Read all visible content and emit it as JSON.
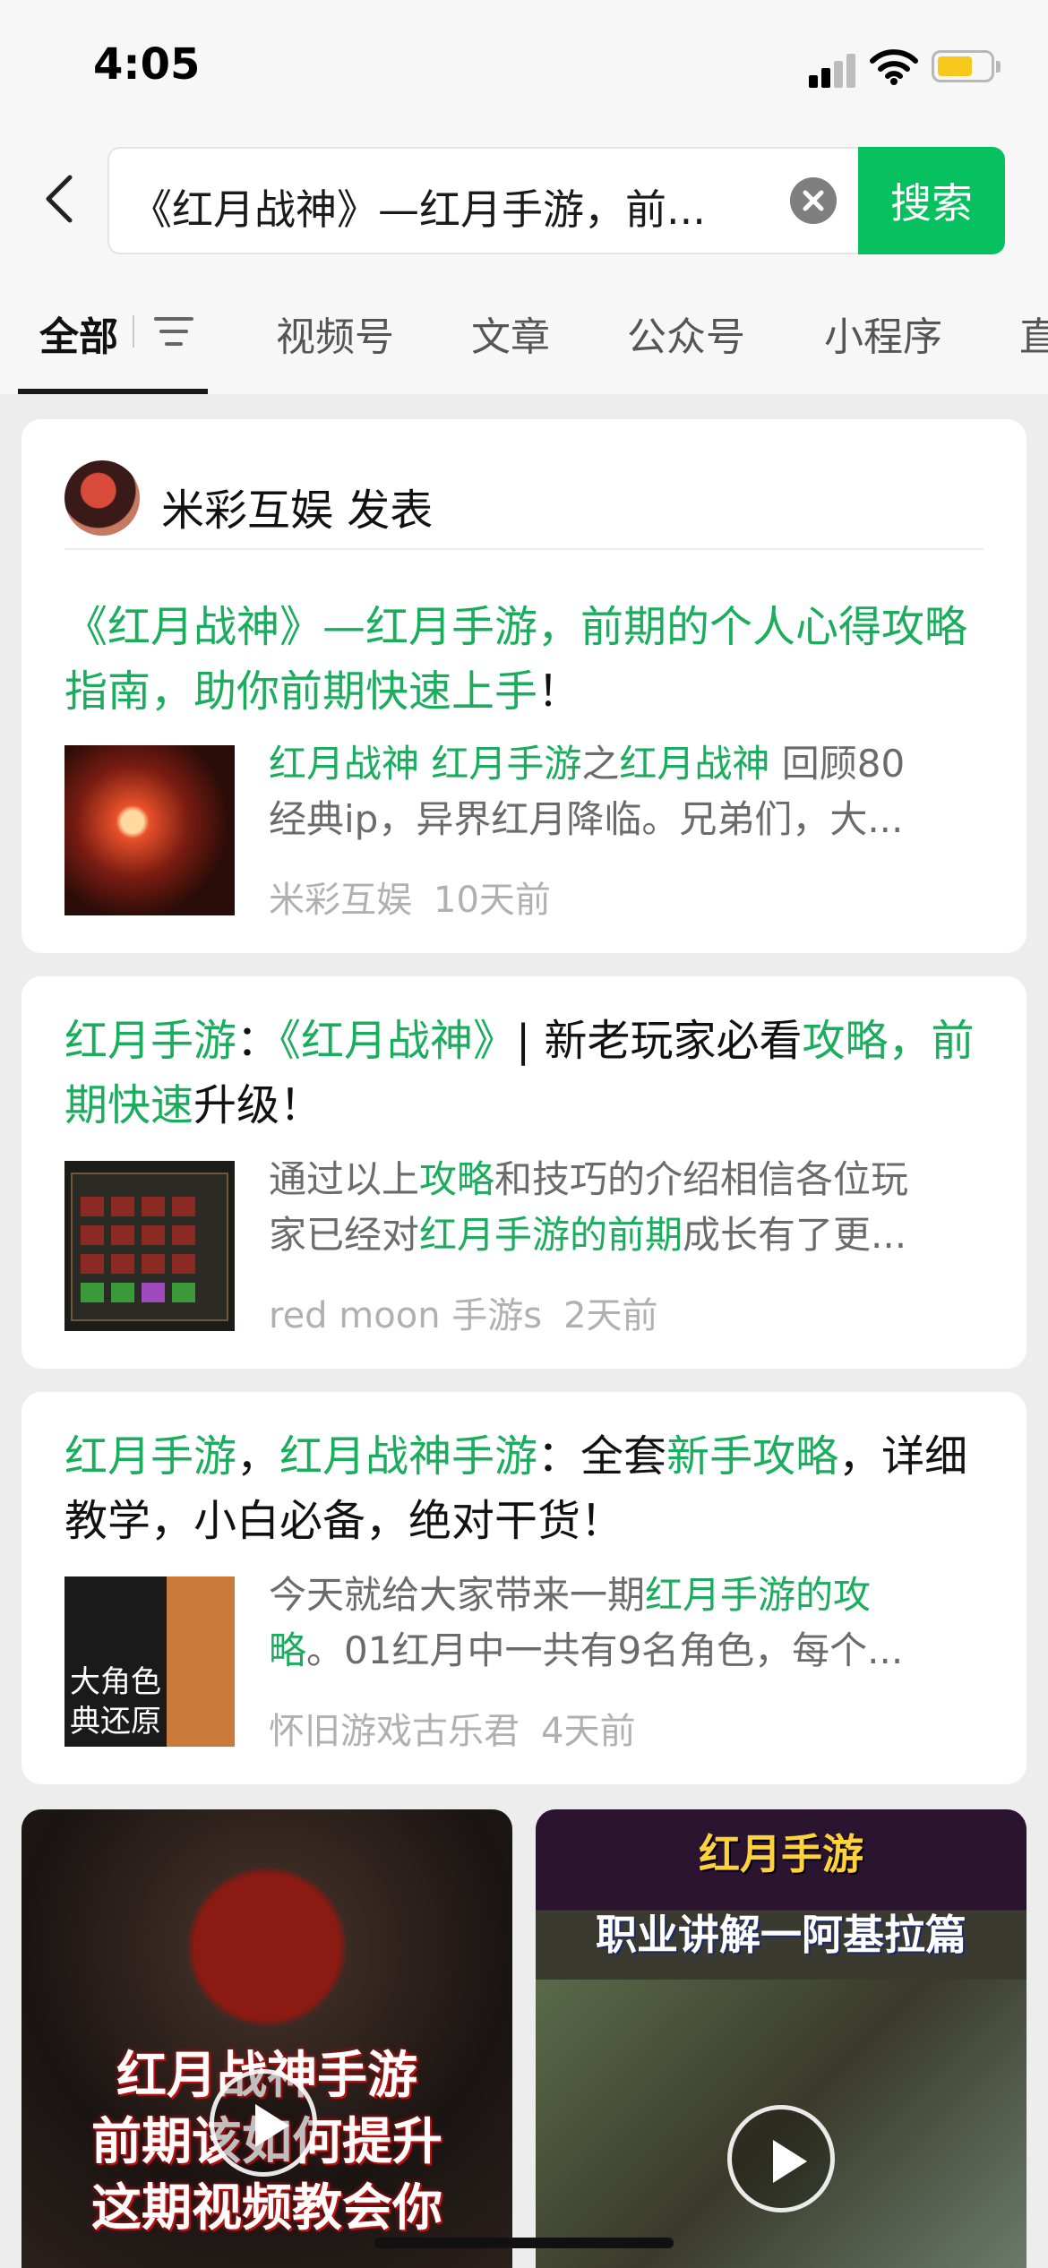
{
  "status": {
    "time": "4:05"
  },
  "search": {
    "query": "《红月战神》—红月手游，前...",
    "button": "搜索"
  },
  "tabs": [
    "全部",
    "视频号",
    "文章",
    "公众号",
    "小程序",
    "直"
  ],
  "results": [
    {
      "publisher": "米彩互娱",
      "publisher_suffix": "发表",
      "title": [
        {
          "t": "《红月战神》—红月手游，前期的个人心得攻略指南，助你前期快速上手",
          "hl": true
        },
        {
          "t": "！",
          "hl": false
        }
      ],
      "snippet": {
        "line1": [
          {
            "t": "红月战神 红月手游",
            "hl": true
          },
          {
            "t": "之",
            "hl": false
          },
          {
            "t": "红月战神",
            "hl": true
          },
          {
            "t": " 回顾80",
            "hl": false
          }
        ],
        "line2": "经典ip，异界红月降临。兄弟们，大..."
      },
      "source": "米彩互娱",
      "time": "10天前"
    },
    {
      "title": [
        {
          "t": "红月手游",
          "hl": true
        },
        {
          "t": "：",
          "hl": false
        },
        {
          "t": "《红月战神》",
          "hl": true
        },
        {
          "t": "| 新老玩家必看",
          "hl": false
        },
        {
          "t": "攻略，前期快速",
          "hl": true
        },
        {
          "t": "升级！",
          "hl": false
        }
      ],
      "snippet": {
        "line1": [
          {
            "t": "通过以上",
            "hl": false
          },
          {
            "t": "攻略",
            "hl": true
          },
          {
            "t": "和技巧的介绍相信各位玩",
            "hl": false
          }
        ],
        "line2_parts": [
          {
            "t": "家已经对",
            "hl": false
          },
          {
            "t": "红月手游的前期",
            "hl": true
          },
          {
            "t": "成长有了更...",
            "hl": false
          }
        ]
      },
      "source": "red moon 手游s",
      "time": "2天前"
    },
    {
      "title": [
        {
          "t": "红月手游",
          "hl": true
        },
        {
          "t": "，",
          "hl": false
        },
        {
          "t": "红月战神手游",
          "hl": true
        },
        {
          "t": "：全套",
          "hl": false
        },
        {
          "t": "新手攻略",
          "hl": true
        },
        {
          "t": "，详细教学，小白必备，绝对干货！",
          "hl": false
        }
      ],
      "snippet": {
        "line1": [
          {
            "t": "今天就给大家带来一期",
            "hl": false
          },
          {
            "t": "红月手游的攻",
            "hl": true
          }
        ],
        "line2_parts": [
          {
            "t": "略",
            "hl": true
          },
          {
            "t": "。01红月中一共有9名角色，每个...",
            "hl": false
          }
        ]
      },
      "thumb_text": [
        "大角色",
        "典还原"
      ],
      "source": "怀旧游戏古乐君",
      "time": "4天前"
    }
  ],
  "videos": [
    {
      "lines": [
        "红月战神手游",
        "前期该如何提升",
        "这期视频教会你"
      ]
    },
    {
      "lines": [
        "红月手游",
        "职业讲解一阿基拉篇"
      ]
    }
  ],
  "colors": {
    "accent": "#07c160",
    "highlight": "#1aad5d"
  }
}
